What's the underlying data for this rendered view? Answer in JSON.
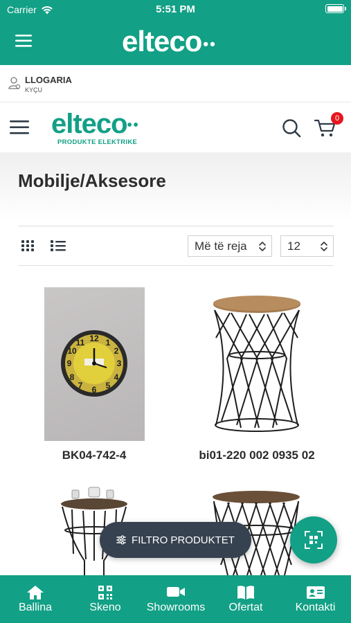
{
  "status_bar": {
    "carrier": "Carrier",
    "time": "5:51 PM"
  },
  "app_bar": {
    "logo_text": "elteco",
    "logo_dots": "••"
  },
  "account": {
    "title": "LLOGARIA",
    "subtitle": "KYÇU"
  },
  "site_header": {
    "brand_text": "elteco",
    "brand_dots": "••",
    "brand_tagline": "PRODUKTE ELEKTRIKE",
    "cart_count": "0"
  },
  "page": {
    "title": "Mobilje/Aksesore"
  },
  "toolbar": {
    "sort_value": "Më të reja",
    "per_page_value": "12"
  },
  "products": [
    {
      "name": "BK04-742-4"
    },
    {
      "name": "bi01-220 002 0935 02"
    }
  ],
  "filter_button": {
    "label": "FILTRO PRODUKTET"
  },
  "tabs": [
    {
      "label": "Ballina",
      "icon": "home-icon"
    },
    {
      "label": "Skeno",
      "icon": "qr-code-icon"
    },
    {
      "label": "Showrooms",
      "icon": "video-camera-icon"
    },
    {
      "label": "Ofertat",
      "icon": "book-icon"
    },
    {
      "label": "Kontakti",
      "icon": "contact-card-icon"
    }
  ],
  "colors": {
    "brand": "#12a086",
    "badge": "#e5161f",
    "filter_pill": "#374250"
  }
}
